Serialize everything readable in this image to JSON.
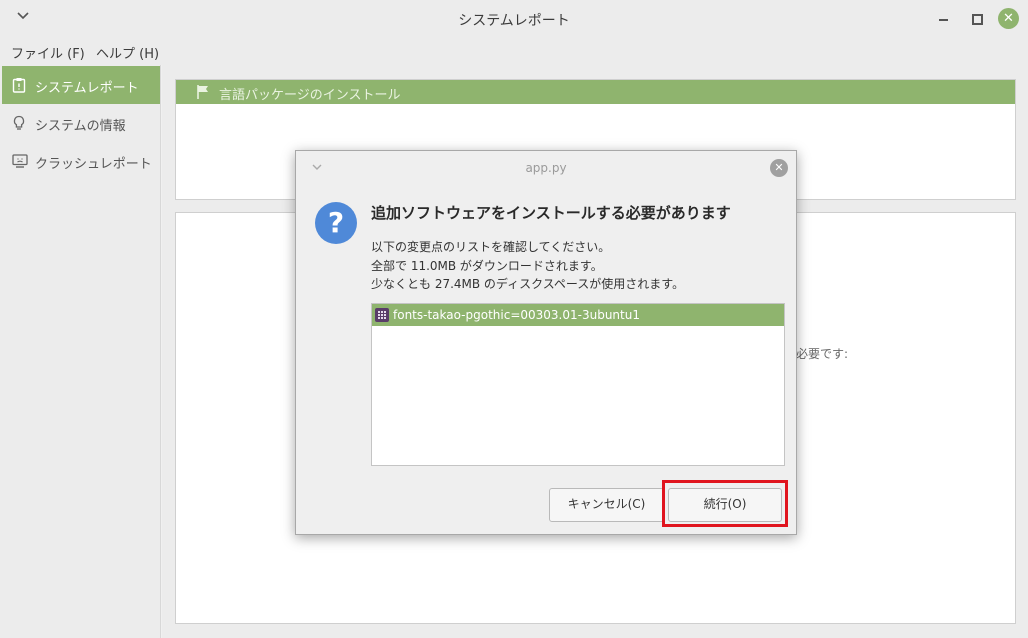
{
  "window": {
    "title": "システムレポート",
    "menu": [
      "ファイル (F)",
      "ヘルプ (H)"
    ]
  },
  "sidebar": {
    "items": [
      {
        "label": "システムレポート",
        "icon": "clipboard-icon",
        "active": true
      },
      {
        "label": "システムの情報",
        "icon": "lightbulb-icon",
        "active": false
      },
      {
        "label": "クラッシュレポート",
        "icon": "monitor-icon",
        "active": false
      }
    ]
  },
  "content": {
    "language_header": "言語パッケージのインストール",
    "background_text": "必要です:"
  },
  "dialog": {
    "title": "app.py",
    "heading": "追加ソフトウェアをインストールする必要があります",
    "lines": [
      "以下の変更点のリストを確認してください。",
      "全部で 11.0MB がダウンロードされます。",
      "少なくとも 27.4MB のディスクスペースが使用されます。"
    ],
    "packages": [
      "fonts-takao-pgothic=00303.01-3ubuntu1"
    ],
    "cancel_label": "キャンセル(C)",
    "continue_label": "続行(O)"
  },
  "colors": {
    "accent": "#8fb46e",
    "question_icon": "#4f89d8",
    "highlight": "#e0141e"
  }
}
